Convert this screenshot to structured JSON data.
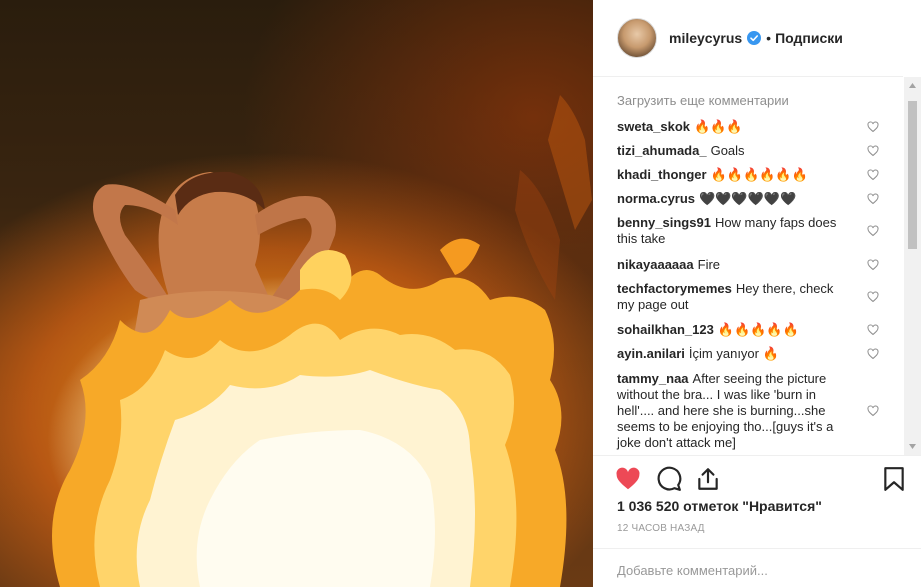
{
  "post": {
    "username": "mileycyrus",
    "follow_label": "Подписки",
    "separator": "•"
  },
  "comments": {
    "load_more": "Загрузить еще комментарии",
    "items": [
      {
        "user": "sweta_skok",
        "text": "🔥🔥🔥"
      },
      {
        "user": "tizi_ahumada_",
        "text": "Goals"
      },
      {
        "user": "khadi_thonger",
        "text": "🔥🔥🔥🔥🔥🔥"
      },
      {
        "user": "norma.cyrus",
        "text": "🖤🖤🖤🖤🖤🖤"
      },
      {
        "user": "benny_sings91",
        "text": "How many faps does this take"
      },
      {
        "user": "nikayaaaaaa",
        "text": "Fire"
      },
      {
        "user": "techfactorymemes",
        "text": "Hey there, check my page out"
      },
      {
        "user": "sohailkhan_123",
        "text": "🔥🔥🔥🔥🔥"
      },
      {
        "user": "ayin.anilari",
        "text": "İçim yanıyor 🔥"
      },
      {
        "user": "tammy_naa",
        "text": "After seeing the picture without the bra... I was like 'burn in hell'.... and here she is burning...she seems to be enjoying tho...[guys it's a joke don't attack me]"
      }
    ]
  },
  "actions": {
    "like_icon": "heart-filled-icon",
    "comment_icon": "comment-bubble-icon",
    "share_icon": "share-icon",
    "save_icon": "bookmark-icon",
    "liked_color": "#ed4956"
  },
  "likes_text": "1 036 520 отметок \"Нравится\"",
  "timestamp": "12 ЧАСОВ НАЗАД",
  "add_comment": {
    "placeholder": "Добавьте комментарий..."
  },
  "colors": {
    "verified": "#3897f0",
    "text": "#262626",
    "muted": "#8e8e8e"
  }
}
